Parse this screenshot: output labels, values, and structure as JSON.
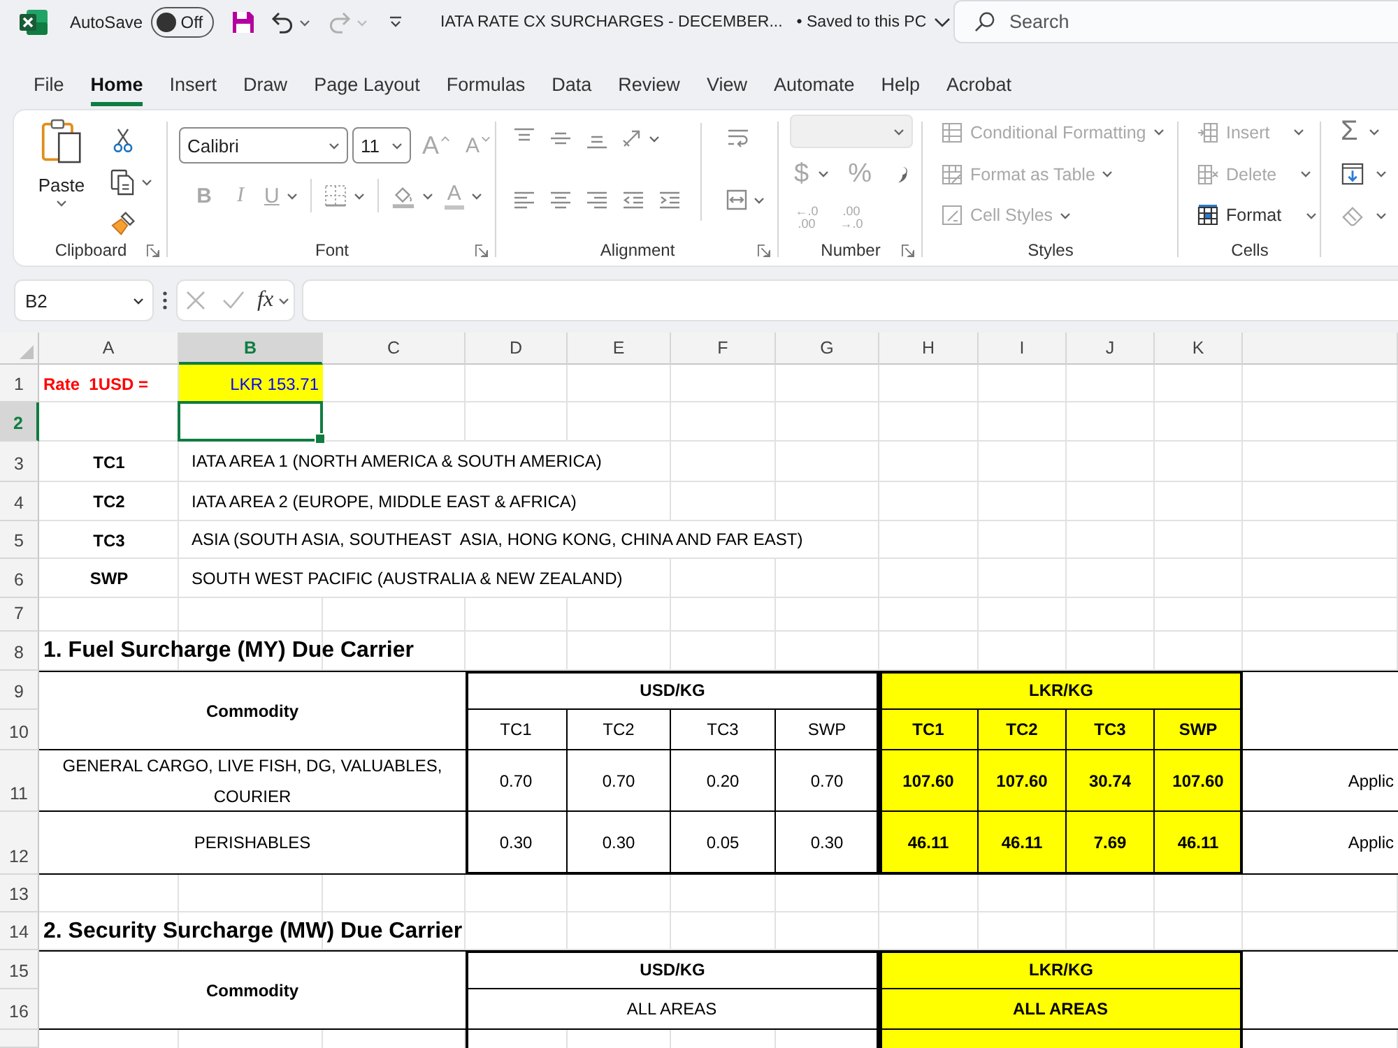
{
  "title_bar": {
    "autosave": {
      "label": "AutoSave",
      "on": false,
      "state": "Off"
    },
    "document_title": "IATA RATE CX SURCHARGES - DECEMBER...",
    "save_status": "• Saved to this PC",
    "search": {
      "placeholder": "Search"
    }
  },
  "menu_tabs": [
    {
      "label": "File",
      "selected": false
    },
    {
      "label": "Home",
      "selected": true
    },
    {
      "label": "Insert",
      "selected": false
    },
    {
      "label": "Draw",
      "selected": false
    },
    {
      "label": "Page Layout",
      "selected": false
    },
    {
      "label": "Formulas",
      "selected": false
    },
    {
      "label": "Data",
      "selected": false
    },
    {
      "label": "Review",
      "selected": false
    },
    {
      "label": "View",
      "selected": false
    },
    {
      "label": "Automate",
      "selected": false
    },
    {
      "label": "Help",
      "selected": false
    },
    {
      "label": "Acrobat",
      "selected": false
    }
  ],
  "ribbon": {
    "clipboard": {
      "label": "Clipboard",
      "paste": "Paste"
    },
    "font": {
      "label": "Font",
      "font_name": "Calibri",
      "font_size": "11",
      "size_buttons": [
        {
          "glyph": "A",
          "disabled": true
        },
        {
          "glyph": "A",
          "disabled": true
        }
      ],
      "style_buttons": [
        {
          "glyph": "B",
          "disabled": true
        },
        {
          "glyph": "I",
          "disabled": true
        },
        {
          "glyph": "U",
          "disabled": true
        }
      ],
      "font_color": {
        "glyph": "A",
        "disabled": true
      }
    },
    "alignment": {
      "label": "Alignment"
    },
    "number": {
      "label": "Number",
      "format_dropdown": {
        "disabled": true
      },
      "symbols": [
        {
          "glyph": "$",
          "disabled": true
        },
        {
          "glyph": "%",
          "disabled": true
        }
      ],
      "decimal_buttons": [
        {
          "top": "←.0",
          "bottom": ".00",
          "disabled": true
        },
        {
          "top": ".00",
          "bottom": "→.0",
          "disabled": true
        }
      ]
    },
    "styles": {
      "label": "Styles",
      "items": [
        {
          "label": "Conditional Formatting",
          "disabled": true
        },
        {
          "label": "Format as Table",
          "disabled": true
        },
        {
          "label": "Cell Styles",
          "disabled": true
        }
      ]
    },
    "cells": {
      "label": "Cells",
      "items": [
        {
          "label": "Insert",
          "disabled": true
        },
        {
          "label": "Delete",
          "disabled": true
        },
        {
          "label": "Format",
          "disabled": false
        }
      ]
    },
    "editing": {
      "autosum": "Σ"
    }
  },
  "formula_bar": {
    "name_box": "B2",
    "function_button": "fx"
  },
  "sheet": {
    "columns": [
      {
        "label": "A",
        "selected": false
      },
      {
        "label": "B",
        "selected": true
      },
      {
        "label": "C",
        "selected": false
      },
      {
        "label": "D",
        "selected": false
      },
      {
        "label": "E",
        "selected": false
      },
      {
        "label": "F",
        "selected": false
      },
      {
        "label": "G",
        "selected": false
      },
      {
        "label": "H",
        "selected": false
      },
      {
        "label": "I",
        "selected": false
      },
      {
        "label": "J",
        "selected": false
      },
      {
        "label": "K",
        "selected": false
      }
    ],
    "rows": [
      {
        "label": "1",
        "selected": false
      },
      {
        "label": "2",
        "selected": true
      },
      {
        "label": "3",
        "selected": false
      },
      {
        "label": "4",
        "selected": false
      },
      {
        "label": "5",
        "selected": false
      },
      {
        "label": "6",
        "selected": false
      },
      {
        "label": "7",
        "selected": false
      },
      {
        "label": "8",
        "selected": false
      },
      {
        "label": "9",
        "selected": false
      },
      {
        "label": "10",
        "selected": false
      },
      {
        "label": "11",
        "selected": false
      },
      {
        "label": "12",
        "selected": false
      },
      {
        "label": "13",
        "selected": false
      },
      {
        "label": "14",
        "selected": false
      },
      {
        "label": "15",
        "selected": false
      },
      {
        "label": "16",
        "selected": false
      }
    ],
    "rate": {
      "label": "Rate  1USD =",
      "value": "LKR 153.71"
    },
    "areas": [
      {
        "code": "TC1",
        "description": "IATA AREA 1 (NORTH AMERICA & SOUTH AMERICA)"
      },
      {
        "code": "TC2",
        "description": "IATA AREA 2 (EUROPE, MIDDLE EAST & AFRICA)"
      },
      {
        "code": "TC3",
        "description": "ASIA (SOUTH ASIA, SOUTHEAST  ASIA, HONG KONG, CHINA AND FAR EAST)"
      },
      {
        "code": "SWP",
        "description": "SOUTH WEST PACIFIC (AUSTRALIA & NEW ZEALAND)"
      }
    ],
    "sections": [
      {
        "title": "1. Fuel Surcharge (MY) Due Carrier",
        "commodity_header": "Commodity",
        "usd_header": "USD/KG",
        "lkr_header": "LKR/KG",
        "usd_subheaders": [
          "TC1",
          "TC2",
          "TC3",
          "SWP"
        ],
        "lkr_subheaders": [
          "TC1",
          "TC2",
          "TC3",
          "SWP"
        ],
        "rows": [
          {
            "commodity": "GENERAL CARGO, LIVE FISH, DG, VALUABLES, COURIER",
            "usd": [
              "0.70",
              "0.70",
              "0.20",
              "0.70"
            ],
            "lkr": [
              "107.60",
              "107.60",
              "30.74",
              "107.60"
            ],
            "column_12": "Applic"
          },
          {
            "commodity": "PERISHABLES",
            "usd": [
              "0.30",
              "0.30",
              "0.05",
              "0.30"
            ],
            "lkr": [
              "46.11",
              "46.11",
              "7.69",
              "46.11"
            ],
            "column_12": "Applic"
          }
        ]
      },
      {
        "title": "2. Security Surcharge (MW) Due Carrier",
        "commodity_header": "Commodity",
        "usd_header": "USD/KG",
        "lkr_header": "LKR/KG",
        "usd_subheaders": [
          "ALL AREAS"
        ],
        "lkr_subheaders": [
          "ALL AREAS"
        ]
      }
    ]
  }
}
